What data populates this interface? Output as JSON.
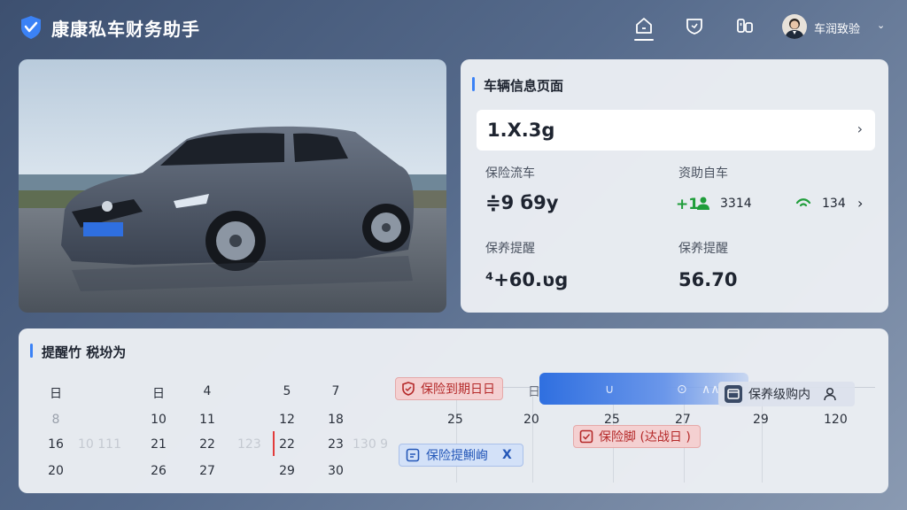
{
  "header": {
    "app_title": "康康私车财务助手",
    "nav_icons": [
      "home-icon",
      "shield-icon",
      "car-icon"
    ],
    "user_name": "车润致验",
    "caret": "⌄"
  },
  "vehicle_info": {
    "title": "车辆信息页面",
    "plate_value": "1.X.3g",
    "chevron": "›",
    "stats": [
      {
        "label": "保险流车",
        "value": "≑9 б9y"
      },
      {
        "label": "资助自车",
        "value_a": "+1",
        "value_b": "3314",
        "value_c": "134",
        "chevron": "›"
      },
      {
        "label": "保养提醒",
        "value": "⁴+6ט.0g"
      },
      {
        "label": "保养提醒",
        "value": "56.70"
      }
    ]
  },
  "reminder": {
    "title": "提醒竹 税坋为",
    "calendar": {
      "header": [
        "日",
        "日",
        "4",
        "5",
        "7"
      ],
      "rows": [
        [
          "8",
          "10",
          "11",
          "12",
          "18"
        ],
        [
          "16",
          "21",
          "22",
          "22",
          "23"
        ],
        [
          "20",
          "26",
          "27",
          "29",
          "30"
        ]
      ],
      "faded_a": "10 111",
      "faded_b": "123",
      "faded_c": "130 9"
    },
    "timeline": {
      "labels": [
        "25",
        "20",
        "25",
        "27",
        "29",
        "120"
      ],
      "bar_glyphs": [
        "日",
        "∪",
        "⊙",
        "∧∧"
      ],
      "events": {
        "insurance_due": "保险到期日日",
        "maintenance_in": "保养级购内",
        "insurance_period": "保险脚 (达战日 )",
        "insurance_reminder": "保险提鯏峋",
        "insurance_reminder_tail": "X"
      }
    }
  },
  "colors": {
    "accent": "#3b82f6",
    "alert_red": "#b52a2a",
    "positive_green": "#1f9d3a",
    "panel_bg": "#eceff4"
  }
}
